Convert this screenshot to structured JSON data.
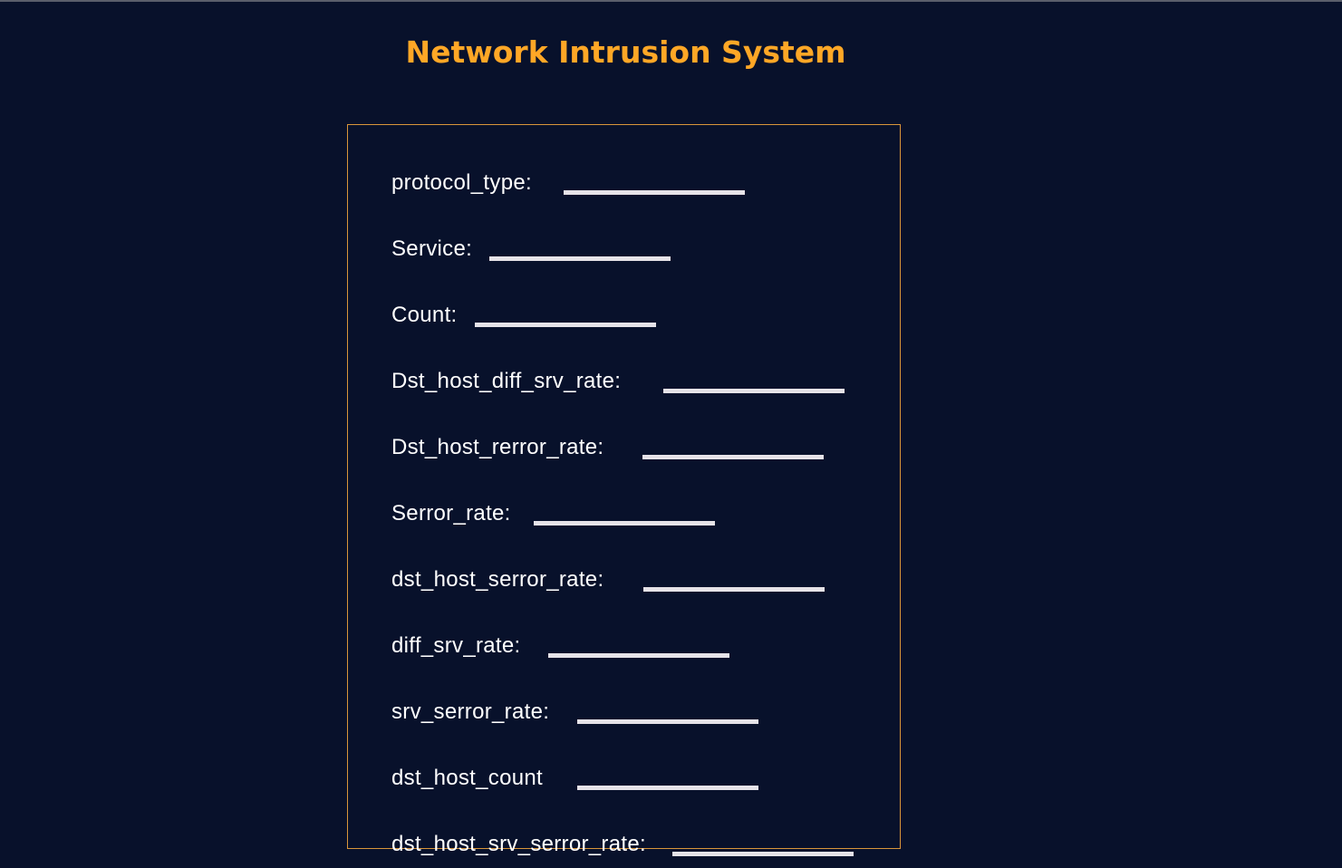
{
  "app": {
    "title": "Network Intrusion System"
  },
  "form": {
    "fields": [
      {
        "label": "protocol_type:",
        "value": ""
      },
      {
        "label": "Service:",
        "value": ""
      },
      {
        "label": "Count:",
        "value": ""
      },
      {
        "label": "Dst_host_diff_srv_rate:",
        "value": ""
      },
      {
        "label": "Dst_host_rerror_rate:",
        "value": ""
      },
      {
        "label": "Serror_rate:",
        "value": ""
      },
      {
        "label": "dst_host_serror_rate:",
        "value": ""
      },
      {
        "label": "diff_srv_rate:",
        "value": ""
      },
      {
        "label": "srv_serror_rate:",
        "value": ""
      },
      {
        "label": "dst_host_count",
        "value": ""
      },
      {
        "label": "dst_host_srv_serror_rate:",
        "value": ""
      }
    ]
  },
  "colors": {
    "background": "#08112b",
    "accent": "#ffa726",
    "border": "#d9963a",
    "input": "#e6e3e8"
  }
}
